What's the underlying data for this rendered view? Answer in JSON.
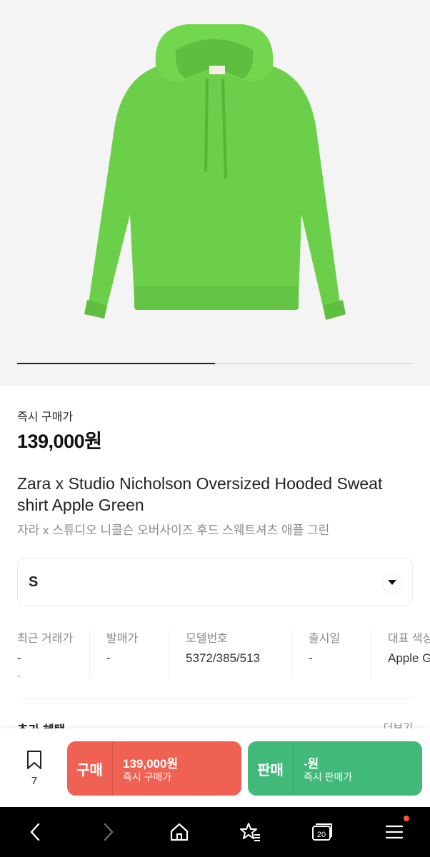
{
  "product": {
    "image_alt": "Apple green oversized hooded sweatshirt",
    "image_color": "#6fd14c",
    "carousel_position": 0.5
  },
  "price": {
    "label": "즉시 구매가",
    "value": "139,000원"
  },
  "title": {
    "en": "Zara x Studio Nicholson Oversized Hooded Sweat shirt Apple Green",
    "ko": "자라 x 스튜디오 니콜슨 오버사이즈 후드 스웨트셔츠 애플 그린"
  },
  "size": {
    "selected": "S"
  },
  "meta": [
    {
      "label": "최근 거래가",
      "value": "-",
      "sub": "-"
    },
    {
      "label": "발매가",
      "value": "-"
    },
    {
      "label": "모델번호",
      "value": "5372/385/513"
    },
    {
      "label": "출시일",
      "value": "-"
    },
    {
      "label": "대표 색상",
      "value": "Apple Green"
    }
  ],
  "benefit": {
    "label": "추가 혜택",
    "more": "더보기"
  },
  "wishlist": {
    "icon": "bookmark-icon",
    "count": "7"
  },
  "buy": {
    "label": "구매",
    "price": "139,000원",
    "sub": "즉시 구매가",
    "color": "#ef6253"
  },
  "sell": {
    "label": "판매",
    "price": "-원",
    "sub": "즉시 판매가",
    "color": "#41b979"
  },
  "nav": {
    "items": [
      "back-icon",
      "forward-icon",
      "home-icon",
      "bookmark-star-icon",
      "tabs-icon",
      "menu-icon"
    ],
    "tabs_count": "20",
    "notification_color": "#ff5a1f"
  }
}
